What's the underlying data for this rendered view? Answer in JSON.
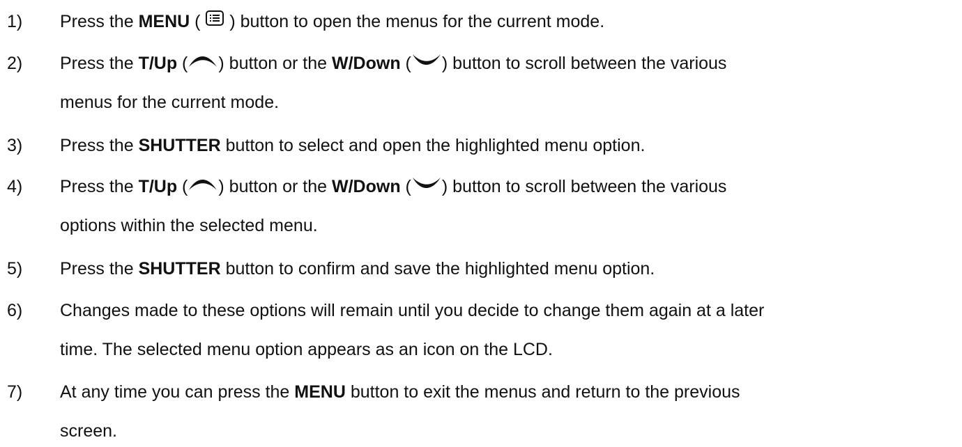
{
  "steps": [
    {
      "number": "1)",
      "lines": [
        {
          "segments": [
            {
              "t": "text",
              "v": "Press the "
            },
            {
              "t": "bold",
              "v": "MENU"
            },
            {
              "t": "text",
              "v": " ( "
            },
            {
              "t": "icon",
              "icon": "menu-list-icon"
            },
            {
              "t": "text",
              "v": " ) button to open the menus for the current mode."
            }
          ]
        }
      ]
    },
    {
      "number": "2)",
      "lines": [
        {
          "segments": [
            {
              "t": "text",
              "v": "Press the "
            },
            {
              "t": "bold",
              "v": "T/Up"
            },
            {
              "t": "text",
              "v": " ("
            },
            {
              "t": "icon",
              "icon": "up-arc-icon"
            },
            {
              "t": "text",
              "v": ") button or the "
            },
            {
              "t": "bold",
              "v": "W/Down"
            },
            {
              "t": "text",
              "v": " ("
            },
            {
              "t": "icon",
              "icon": "down-arc-icon"
            },
            {
              "t": "text",
              "v": ") button to scroll between the various"
            }
          ]
        },
        {
          "segments": [
            {
              "t": "text",
              "v": "menus for the current mode."
            }
          ]
        }
      ]
    },
    {
      "number": "3)",
      "lines": [
        {
          "segments": [
            {
              "t": "text",
              "v": "Press the "
            },
            {
              "t": "bold",
              "v": "SHUTTER"
            },
            {
              "t": "text",
              "v": " button to select and open the highlighted menu option."
            }
          ]
        }
      ]
    },
    {
      "number": "4)",
      "lines": [
        {
          "segments": [
            {
              "t": "text",
              "v": "Press the "
            },
            {
              "t": "bold",
              "v": "T/Up"
            },
            {
              "t": "text",
              "v": " ("
            },
            {
              "t": "icon",
              "icon": "up-arc-icon"
            },
            {
              "t": "text",
              "v": ") button or the "
            },
            {
              "t": "bold",
              "v": "W/Down"
            },
            {
              "t": "text",
              "v": " ("
            },
            {
              "t": "icon",
              "icon": "down-arc-icon"
            },
            {
              "t": "text",
              "v": ") button to scroll between the various"
            }
          ]
        },
        {
          "segments": [
            {
              "t": "text",
              "v": "options within the selected menu."
            }
          ]
        }
      ]
    },
    {
      "number": "5)",
      "lines": [
        {
          "segments": [
            {
              "t": "text",
              "v": "Press the "
            },
            {
              "t": "bold",
              "v": "SHUTTER"
            },
            {
              "t": "text",
              "v": " button to confirm and save the highlighted menu option."
            }
          ]
        }
      ]
    },
    {
      "number": "6)",
      "lines": [
        {
          "segments": [
            {
              "t": "text",
              "v": "Changes made to these options will remain until you decide to change them again at a later"
            }
          ]
        },
        {
          "segments": [
            {
              "t": "text",
              "v": "time. The selected menu option appears as an icon on the LCD."
            }
          ]
        }
      ]
    },
    {
      "number": "7)",
      "lines": [
        {
          "segments": [
            {
              "t": "text",
              "v": "At any time you can press the "
            },
            {
              "t": "bold",
              "v": "MENU"
            },
            {
              "t": "text",
              "v": " button to exit the menus and return to the previous"
            }
          ]
        },
        {
          "segments": [
            {
              "t": "text",
              "v": "screen."
            }
          ]
        }
      ]
    }
  ]
}
